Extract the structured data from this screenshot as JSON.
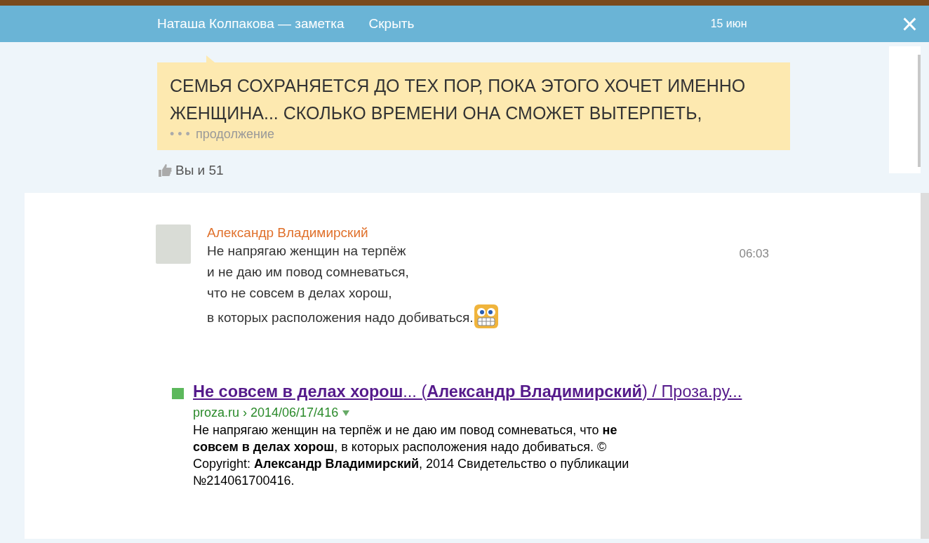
{
  "header": {
    "title": "Наташа Колпакова — заметка",
    "hide_link": "Скрыть",
    "date": "15 июн",
    "close": "×"
  },
  "note": {
    "text": "СЕМЬЯ СОХРАНЯЕТСЯ ДО ТЕХ ПОР, ПОКА ЭТОГО ХОЧЕТ ИМЕННО ЖЕНЩИНА... СКОЛЬКО ВРЕМЕНИ ОНА СМОЖЕТ ВЫТЕРПЕТЬ,",
    "more_dots": "• • •",
    "more": "продолжение",
    "likes": "Вы и 51"
  },
  "comment": {
    "author": "Александр Владимирский",
    "time": "06:03",
    "lines": [
      "Не напрягаю женщин на терпёж",
      "и не даю им повод сомневаться,",
      "что не совсем в делах хорош,",
      "в которых расположения надо добиваться."
    ]
  },
  "search_result": {
    "title": "**Не совсем в делах хорош**... (**Александр Владимирский**) / Проза.ру...",
    "url": "proza.ru › 2014/06/17/416",
    "snippet": "Не напрягаю женщин на терпёж и не даю им повод сомневаться, что **не совсем в делах хорош**, в которых расположения надо добиваться. © Copyright: **Александр Владимирский**, 2014 Свидетельство о публикации №214061700416."
  }
}
